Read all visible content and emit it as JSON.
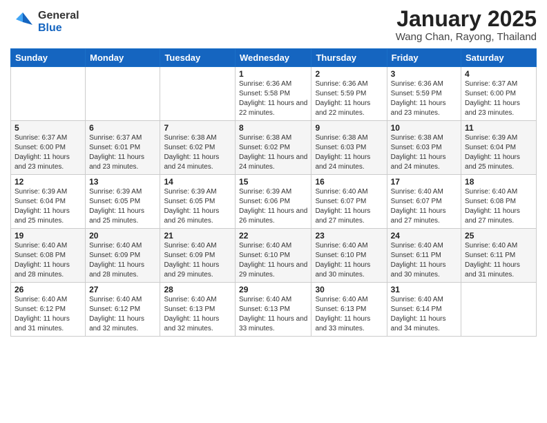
{
  "logo": {
    "general": "General",
    "blue": "Blue"
  },
  "title": "January 2025",
  "location": "Wang Chan, Rayong, Thailand",
  "days_of_week": [
    "Sunday",
    "Monday",
    "Tuesday",
    "Wednesday",
    "Thursday",
    "Friday",
    "Saturday"
  ],
  "weeks": [
    [
      {
        "day": "",
        "info": ""
      },
      {
        "day": "",
        "info": ""
      },
      {
        "day": "",
        "info": ""
      },
      {
        "day": "1",
        "info": "Sunrise: 6:36 AM\nSunset: 5:58 PM\nDaylight: 11 hours and 22 minutes."
      },
      {
        "day": "2",
        "info": "Sunrise: 6:36 AM\nSunset: 5:59 PM\nDaylight: 11 hours and 22 minutes."
      },
      {
        "day": "3",
        "info": "Sunrise: 6:36 AM\nSunset: 5:59 PM\nDaylight: 11 hours and 23 minutes."
      },
      {
        "day": "4",
        "info": "Sunrise: 6:37 AM\nSunset: 6:00 PM\nDaylight: 11 hours and 23 minutes."
      }
    ],
    [
      {
        "day": "5",
        "info": "Sunrise: 6:37 AM\nSunset: 6:00 PM\nDaylight: 11 hours and 23 minutes."
      },
      {
        "day": "6",
        "info": "Sunrise: 6:37 AM\nSunset: 6:01 PM\nDaylight: 11 hours and 23 minutes."
      },
      {
        "day": "7",
        "info": "Sunrise: 6:38 AM\nSunset: 6:02 PM\nDaylight: 11 hours and 24 minutes."
      },
      {
        "day": "8",
        "info": "Sunrise: 6:38 AM\nSunset: 6:02 PM\nDaylight: 11 hours and 24 minutes."
      },
      {
        "day": "9",
        "info": "Sunrise: 6:38 AM\nSunset: 6:03 PM\nDaylight: 11 hours and 24 minutes."
      },
      {
        "day": "10",
        "info": "Sunrise: 6:38 AM\nSunset: 6:03 PM\nDaylight: 11 hours and 24 minutes."
      },
      {
        "day": "11",
        "info": "Sunrise: 6:39 AM\nSunset: 6:04 PM\nDaylight: 11 hours and 25 minutes."
      }
    ],
    [
      {
        "day": "12",
        "info": "Sunrise: 6:39 AM\nSunset: 6:04 PM\nDaylight: 11 hours and 25 minutes."
      },
      {
        "day": "13",
        "info": "Sunrise: 6:39 AM\nSunset: 6:05 PM\nDaylight: 11 hours and 25 minutes."
      },
      {
        "day": "14",
        "info": "Sunrise: 6:39 AM\nSunset: 6:05 PM\nDaylight: 11 hours and 26 minutes."
      },
      {
        "day": "15",
        "info": "Sunrise: 6:39 AM\nSunset: 6:06 PM\nDaylight: 11 hours and 26 minutes."
      },
      {
        "day": "16",
        "info": "Sunrise: 6:40 AM\nSunset: 6:07 PM\nDaylight: 11 hours and 27 minutes."
      },
      {
        "day": "17",
        "info": "Sunrise: 6:40 AM\nSunset: 6:07 PM\nDaylight: 11 hours and 27 minutes."
      },
      {
        "day": "18",
        "info": "Sunrise: 6:40 AM\nSunset: 6:08 PM\nDaylight: 11 hours and 27 minutes."
      }
    ],
    [
      {
        "day": "19",
        "info": "Sunrise: 6:40 AM\nSunset: 6:08 PM\nDaylight: 11 hours and 28 minutes."
      },
      {
        "day": "20",
        "info": "Sunrise: 6:40 AM\nSunset: 6:09 PM\nDaylight: 11 hours and 28 minutes."
      },
      {
        "day": "21",
        "info": "Sunrise: 6:40 AM\nSunset: 6:09 PM\nDaylight: 11 hours and 29 minutes."
      },
      {
        "day": "22",
        "info": "Sunrise: 6:40 AM\nSunset: 6:10 PM\nDaylight: 11 hours and 29 minutes."
      },
      {
        "day": "23",
        "info": "Sunrise: 6:40 AM\nSunset: 6:10 PM\nDaylight: 11 hours and 30 minutes."
      },
      {
        "day": "24",
        "info": "Sunrise: 6:40 AM\nSunset: 6:11 PM\nDaylight: 11 hours and 30 minutes."
      },
      {
        "day": "25",
        "info": "Sunrise: 6:40 AM\nSunset: 6:11 PM\nDaylight: 11 hours and 31 minutes."
      }
    ],
    [
      {
        "day": "26",
        "info": "Sunrise: 6:40 AM\nSunset: 6:12 PM\nDaylight: 11 hours and 31 minutes."
      },
      {
        "day": "27",
        "info": "Sunrise: 6:40 AM\nSunset: 6:12 PM\nDaylight: 11 hours and 32 minutes."
      },
      {
        "day": "28",
        "info": "Sunrise: 6:40 AM\nSunset: 6:13 PM\nDaylight: 11 hours and 32 minutes."
      },
      {
        "day": "29",
        "info": "Sunrise: 6:40 AM\nSunset: 6:13 PM\nDaylight: 11 hours and 33 minutes."
      },
      {
        "day": "30",
        "info": "Sunrise: 6:40 AM\nSunset: 6:13 PM\nDaylight: 11 hours and 33 minutes."
      },
      {
        "day": "31",
        "info": "Sunrise: 6:40 AM\nSunset: 6:14 PM\nDaylight: 11 hours and 34 minutes."
      },
      {
        "day": "",
        "info": ""
      }
    ]
  ]
}
